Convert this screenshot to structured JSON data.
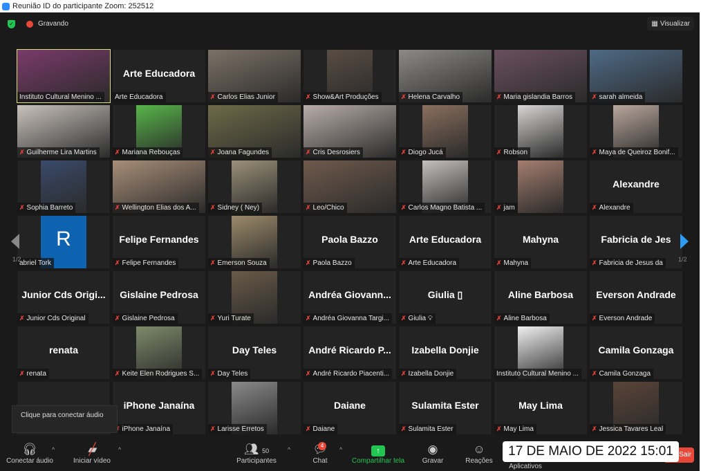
{
  "window": {
    "title": "Reunião ID do participante Zoom: 252512"
  },
  "topbar": {
    "recording_label": "Gravando",
    "view_label": "Visualizar"
  },
  "pagination": {
    "left": "1/2",
    "right": "1/2"
  },
  "tooltip": "Clique para conectar áudio",
  "tiles": [
    {
      "label": "Instituto Cultural Menino ...",
      "kind": "video-wide",
      "color": "#7a3a6a",
      "active": true,
      "muted": false
    },
    {
      "label": "Arte Educadora",
      "big": "Arte Educadora",
      "muted": false
    },
    {
      "label": "Carlos Elias Junior",
      "kind": "video-wide",
      "color": "#7c7166",
      "muted": true
    },
    {
      "label": "Show&Art Produções",
      "kind": "video-portrait",
      "color": "#5a4d43",
      "muted": true
    },
    {
      "label": "Helena Carvalho",
      "kind": "video-wide",
      "color": "#8d8a86",
      "muted": true
    },
    {
      "label": "Maria gislandia Barros",
      "kind": "video-wide",
      "color": "#6a4f5e",
      "muted": true
    },
    {
      "label": "sarah almeida",
      "kind": "video-wide",
      "color": "#4e6a86",
      "muted": true
    },
    {
      "label": "Guilherme Lira Martins",
      "kind": "video-wide",
      "color": "#c9c2bc",
      "muted": true
    },
    {
      "label": "Mariana Rebouças",
      "kind": "video-portrait",
      "color": "#58b54a",
      "muted": true
    },
    {
      "label": "Joana Fagundes",
      "kind": "video-wide",
      "color": "#6e6a48",
      "muted": true
    },
    {
      "label": "Cris Desrosiers",
      "kind": "video-wide",
      "color": "#b9aea9",
      "muted": true
    },
    {
      "label": "Diogo Jucá",
      "kind": "video-portrait",
      "color": "#8a6f5e",
      "muted": true
    },
    {
      "label": "Robson",
      "kind": "video-portrait",
      "color": "#d8d6d4",
      "muted": true
    },
    {
      "label": "Maya de Queiroz Bonif...",
      "kind": "video-portrait",
      "color": "#b9a79c",
      "muted": true
    },
    {
      "label": "Sophia Barreto",
      "kind": "video-portrait",
      "color": "#3a4a6a",
      "muted": true
    },
    {
      "label": "Wellington Elias dos A...",
      "kind": "video-wide",
      "color": "#a88e78",
      "muted": true
    },
    {
      "label": "Sidney ( Ney)",
      "kind": "video-portrait",
      "color": "#9b9078",
      "muted": true
    },
    {
      "label": "Leo/Chico",
      "kind": "video-wide",
      "color": "#6f5a4c",
      "muted": true
    },
    {
      "label": "Carlos Magno Batista ...",
      "kind": "video-portrait",
      "color": "#c4c0bc",
      "muted": true
    },
    {
      "label": "jam",
      "kind": "video-portrait",
      "color": "#a57e70",
      "muted": true
    },
    {
      "label": "Alexandre",
      "big": "Alexandre",
      "muted": true
    },
    {
      "label": "abriel Tork",
      "kind": "avatar",
      "avatar_letter": "R",
      "color": "#0e63b0",
      "muted": false
    },
    {
      "label": "Felipe Fernandes",
      "big": "Felipe Fernandes",
      "muted": true
    },
    {
      "label": "Emerson Souza",
      "kind": "video-portrait",
      "color": "#9c8a6a",
      "muted": true
    },
    {
      "label": "Paola Bazzo",
      "big": "Paola Bazzo",
      "muted": true
    },
    {
      "label": "Arte Educadora",
      "big": "Arte Educadora",
      "muted": true
    },
    {
      "label": "Mahyna",
      "big": "Mahyna",
      "muted": true
    },
    {
      "label": "Fabricia de Jesus da",
      "big": "Fabricia de Jes",
      "muted": true
    },
    {
      "label": "Junior Cds Original",
      "big": "Junior Cds Origi...",
      "muted": true
    },
    {
      "label": "Gislaine Pedrosa",
      "big": "Gislaine Pedrosa",
      "muted": true
    },
    {
      "label": "Yuri Turate",
      "kind": "video-portrait",
      "color": "#6a5a48",
      "muted": true
    },
    {
      "label": "Andréa Giovanna Targi...",
      "big": "Andréa Giovann...",
      "muted": true
    },
    {
      "label": "Giulia",
      "big": "Giulia ▯",
      "muted": true,
      "extra_icon": "lightbulb-icon"
    },
    {
      "label": "Aline Barbosa",
      "big": "Aline Barbosa",
      "muted": true
    },
    {
      "label": "Everson Andrade",
      "big": "Everson Andrade",
      "muted": true
    },
    {
      "label": "renata",
      "big": "renata",
      "muted": true
    },
    {
      "label": "Keite Elen Rodrigues S...",
      "kind": "video-portrait",
      "color": "#7e8a6a",
      "muted": true
    },
    {
      "label": "Day Teles",
      "big": "Day Teles",
      "muted": true
    },
    {
      "label": "André Ricardo Piacenti...",
      "big": "André Ricardo P...",
      "muted": true
    },
    {
      "label": "Izabella Donjie",
      "big": "Izabella Donjie",
      "muted": true
    },
    {
      "label": "Instituto Cultural Menino ...",
      "kind": "video-portrait",
      "color": "#f0f0f0",
      "muted": false
    },
    {
      "label": "Camila Gonzaga",
      "big": "Camila Gonzaga",
      "muted": true
    },
    {
      "label": "",
      "big": "",
      "muted": false
    },
    {
      "label": "iPhone Janaína",
      "big": "iPhone Janaína",
      "muted": true
    },
    {
      "label": "Larisse Erretos",
      "kind": "video-portrait",
      "color": "#8a8a8a",
      "muted": true
    },
    {
      "label": "Daiane",
      "big": "Daiane",
      "muted": true
    },
    {
      "label": "Sulamita Ester",
      "big": "Sulamita Ester",
      "muted": true
    },
    {
      "label": "May Lima",
      "big": "May Lima",
      "muted": true
    },
    {
      "label": "Jessica Tavares Leal",
      "kind": "video-portrait",
      "color": "#5a4438",
      "muted": true
    }
  ],
  "toolbar": {
    "audio": "Conectar áudio",
    "video": "Iniciar vídeo",
    "participants": "Participantes",
    "participants_count": "50",
    "chat": "Chat",
    "chat_badge": "4",
    "share": "Compartilhar tela",
    "record": "Gravar",
    "reactions": "Reações",
    "apps": "Aplicativos",
    "leave": "Sair"
  },
  "overlay_datetime": "17 DE MAIO DE 2022 15:01",
  "colors": {
    "accent_green": "#23c552",
    "mute_red": "#e0413a",
    "leave_red": "#e8483a",
    "active_speaker": "#d9e27a",
    "next_arrow": "#2d9cf0"
  }
}
